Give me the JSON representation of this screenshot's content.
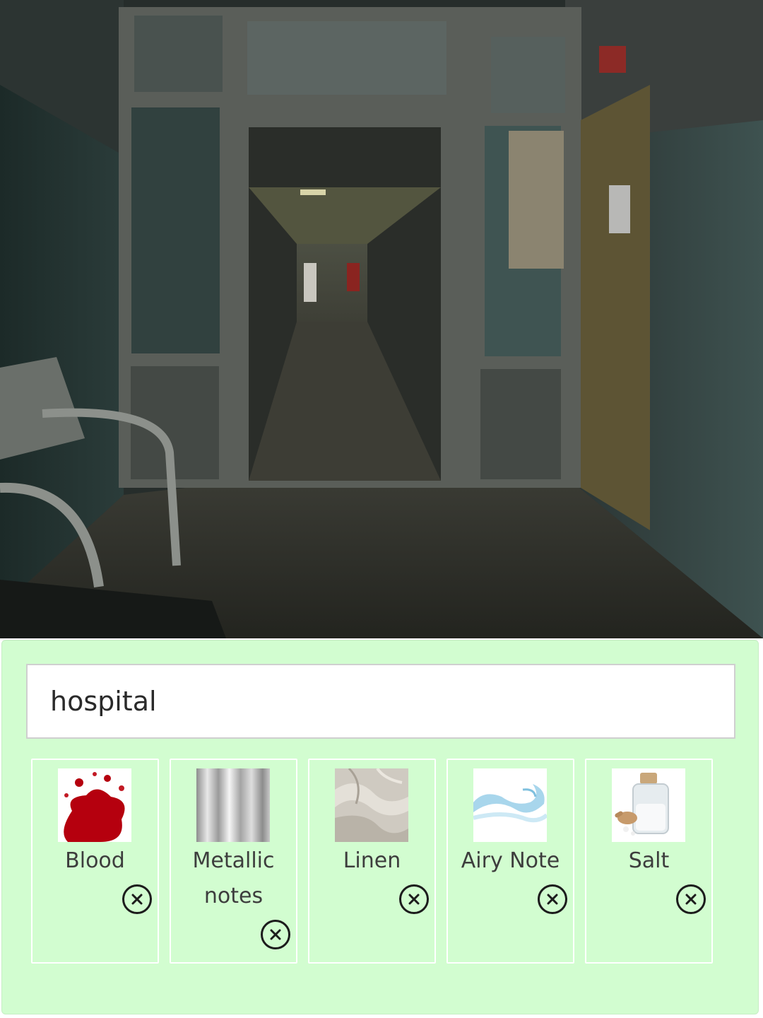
{
  "search": {
    "value": "hospital"
  },
  "hero": {
    "icon": "hospital-corridor-photo"
  },
  "scents": [
    {
      "label": "Blood",
      "thumb_icon": "blood-splatter-image",
      "remove_icon": "close-circle-icon"
    },
    {
      "label": "Metallic notes",
      "thumb_icon": "brushed-metal-image",
      "remove_icon": "close-circle-icon"
    },
    {
      "label": "Linen",
      "thumb_icon": "linen-fabric-image",
      "remove_icon": "close-circle-icon"
    },
    {
      "label": "Airy Note",
      "thumb_icon": "air-swirl-image",
      "remove_icon": "close-circle-icon"
    },
    {
      "label": "Salt",
      "thumb_icon": "salt-jar-image",
      "remove_icon": "close-circle-icon"
    }
  ],
  "colors": {
    "panel_background": "#d2fdd0",
    "card_border": "#ffffff",
    "blood_red": "#b5000e"
  }
}
